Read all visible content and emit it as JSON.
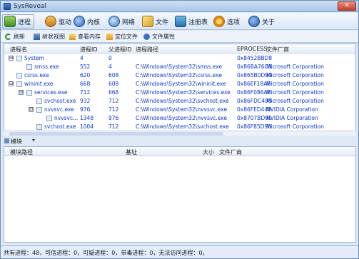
{
  "window": {
    "title": "SysReveal",
    "close_glyph": "✕"
  },
  "tabs": [
    {
      "label": "进程",
      "icon": "process-icon"
    },
    {
      "label": "驱动",
      "icon": "driver-icon"
    },
    {
      "label": "内核",
      "icon": "kernel-icon"
    },
    {
      "label": "网络",
      "icon": "network-icon"
    },
    {
      "label": "文件",
      "icon": "file-icon"
    },
    {
      "label": "注册表",
      "icon": "registry-icon"
    },
    {
      "label": "选项",
      "icon": "options-icon"
    },
    {
      "label": "关于",
      "icon": "about-icon"
    }
  ],
  "actions": [
    {
      "label": "刷新",
      "icon": "refresh-icon"
    },
    {
      "label": "树状视图",
      "icon": "tree-view-icon"
    },
    {
      "label": "查看内存",
      "icon": "memory-icon"
    },
    {
      "label": "定位文件",
      "icon": "locate-file-icon"
    },
    {
      "label": "文件属性",
      "icon": "file-properties-icon"
    }
  ],
  "process_table": {
    "columns": [
      "进程名",
      "进程ID",
      "父进程ID",
      "进程路径",
      "EPROCESS",
      "文件厂商"
    ],
    "rows": [
      {
        "name": "System",
        "pid": "4",
        "ppid": "0",
        "path": "",
        "eprocess": "0x8452BBD8",
        "vendor": "",
        "depth": 0,
        "expander": "⊟"
      },
      {
        "name": "smss.exe",
        "pid": "552",
        "ppid": "4",
        "path": "C:\\Windows\\System32\\smss.exe",
        "eprocess": "0x86BA76C8",
        "vendor": "Microsoft Corporation",
        "depth": 1,
        "expander": ""
      },
      {
        "name": "csrss.exe",
        "pid": "620",
        "ppid": "608",
        "path": "C:\\Windows\\System32\\csrss.exe",
        "eprocess": "0x865B0D90",
        "vendor": "Microsoft Corporation",
        "depth": 0,
        "expander": ""
      },
      {
        "name": "wininit.exe",
        "pid": "668",
        "ppid": "608",
        "path": "C:\\Windows\\System32\\wininit.exe",
        "eprocess": "0x86EF18A8",
        "vendor": "Microsoft Corporation",
        "depth": 0,
        "expander": "⊟"
      },
      {
        "name": "services.exe",
        "pid": "712",
        "ppid": "668",
        "path": "C:\\Windows\\System32\\services.exe",
        "eprocess": "0x86F086A8",
        "vendor": "Microsoft Corporation",
        "depth": 1,
        "expander": "⊟"
      },
      {
        "name": "svchost.exe",
        "pid": "932",
        "ppid": "712",
        "path": "C:\\Windows\\System32\\svchost.exe",
        "eprocess": "0x86FDC408",
        "vendor": "Microsoft Corporation",
        "depth": 2,
        "expander": ""
      },
      {
        "name": "nvvsvc.exe",
        "pid": "976",
        "ppid": "712",
        "path": "C:\\Windows\\System32\\nvvsvc.exe",
        "eprocess": "0x86FED448",
        "vendor": "NVIDIA Corporation",
        "depth": 2,
        "expander": "⊟"
      },
      {
        "name": "nvvsvc...",
        "pid": "1348",
        "ppid": "976",
        "path": "C:\\Windows\\System32\\nvvsvc.exe",
        "eprocess": "0x8707BD90",
        "vendor": "NVIDIA Corporation",
        "depth": 3,
        "expander": ""
      },
      {
        "name": "svchost.exe",
        "pid": "1004",
        "ppid": "712",
        "path": "C:\\Windows\\System32\\svchost.exe",
        "eprocess": "0x86F85D90",
        "vendor": "Microsoft Corporation",
        "depth": 2,
        "expander": ""
      }
    ]
  },
  "modules": {
    "label": "模块",
    "arrow": "▾",
    "columns": [
      "模块路径",
      "基址",
      "大小",
      "文件厂商"
    ]
  },
  "status": {
    "text": "共有进程：48，可信进程：0，可疑进程：0，带毒进程：0，无法访问进程：0。"
  },
  "colors": {
    "accent": "#0f38c7",
    "title_gradient_top": "#cfe0f4"
  }
}
